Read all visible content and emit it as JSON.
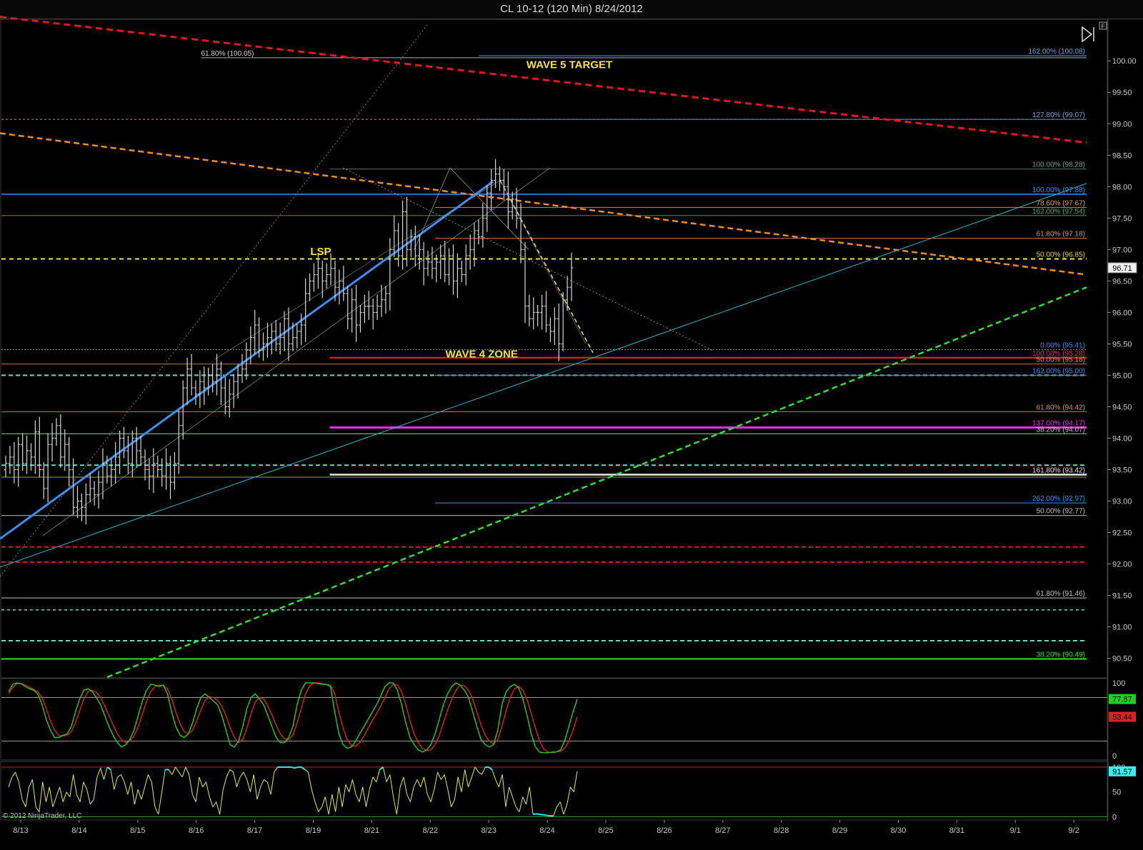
{
  "window": {
    "title": "CL 10-12 (120 Min)  8/24/2012"
  },
  "copyright": "© 2012 NinjaTrader, LLC",
  "colors": {
    "bar": "#d8d8d8",
    "red": "#e8141e",
    "orange": "#f28c1c",
    "green": "#2fe02f",
    "blue": "#3b8ff0",
    "cyan": "#1fb8c8",
    "yellow": "#f5e23c",
    "magenta": "#e62ee6",
    "teal_dash": "#58e0c8",
    "stoch_k": "#20d020",
    "stoch_d": "#e02020",
    "lower2": "#e8e84a",
    "lower2_hi": "#30e8f0"
  },
  "chart_data": [
    {
      "type": "candlestick",
      "symbol": "CL 10-12",
      "interval": "120 Min",
      "ylim": [
        90.2,
        100.65
      ],
      "yticks": [
        "100.00",
        "99.50",
        "99.00",
        "98.50",
        "98.00",
        "97.50",
        "97.00",
        "96.50",
        "96.00",
        "95.50",
        "95.00",
        "94.50",
        "94.00",
        "93.50",
        "93.00",
        "92.50",
        "92.00",
        "91.50",
        "91.00",
        "90.50"
      ],
      "xticks": [
        "8/13",
        "8/14",
        "8/15",
        "8/16",
        "8/17",
        "8/19",
        "8/21",
        "8/22",
        "8/23",
        "8/24",
        "8/25",
        "8/26",
        "8/27",
        "8/28",
        "8/29",
        "8/30",
        "8/31",
        "9/1",
        "9/2"
      ],
      "last_price": "96.71",
      "bars_close": [
        93.6,
        93.7,
        93.5,
        93.9,
        93.6,
        93.8,
        93.7,
        94.1,
        93.5,
        93.2,
        93.9,
        94.0,
        94.2,
        93.7,
        93.9,
        93.5,
        92.9,
        93.0,
        92.9,
        93.1,
        93.2,
        93.1,
        93.3,
        93.6,
        93.4,
        93.5,
        93.7,
        94.0,
        93.8,
        93.6,
        94.0,
        93.8,
        93.7,
        93.5,
        93.4,
        93.6,
        93.5,
        93.4,
        93.6,
        93.3,
        93.6,
        94.2,
        94.8,
        95.1,
        94.8,
        94.7,
        94.9,
        94.8,
        95.0,
        94.9,
        95.1,
        94.8,
        94.5,
        94.7,
        94.9,
        95.0,
        95.1,
        95.4,
        95.6,
        95.8,
        95.4,
        95.5,
        95.6,
        95.7,
        95.5,
        95.6,
        95.9,
        95.5,
        95.6,
        95.7,
        95.8,
        96.3,
        96.5,
        96.6,
        96.7,
        96.5,
        96.6,
        96.7,
        96.4,
        96.5,
        96.3,
        95.9,
        96.2,
        95.8,
        96.0,
        96.1,
        96.1,
        96.0,
        96.1,
        96.2,
        96.3,
        97.0,
        97.3,
        96.9,
        97.6,
        97.0,
        97.2,
        96.9,
        97.0,
        96.7,
        96.8,
        96.7,
        96.8,
        96.9,
        96.6,
        96.9,
        96.5,
        96.7,
        96.6,
        96.9,
        97.0,
        97.3,
        97.2,
        97.5,
        97.9,
        98.1,
        98.2,
        98.1,
        98.0,
        97.6,
        97.8,
        97.5,
        97.0,
        96.1,
        95.9,
        96.0,
        96.0,
        96.1,
        95.8,
        95.7,
        95.9,
        95.5,
        96.2,
        96.4,
        96.71
      ],
      "current_bar": {
        "open": 96.45,
        "high": 96.85,
        "low": 96.45,
        "close": 96.71
      },
      "annotations": [
        {
          "text": "WAVE 5 TARGET",
          "price": 99.95,
          "date_index": 9.5
        },
        {
          "text": "LSP",
          "price": 96.98,
          "date_index": 5.25
        },
        {
          "text": "WAVE 4 ZONE",
          "price": 95.35,
          "date_index": 8.0
        }
      ],
      "h_levels": [
        {
          "price": 100.05,
          "color": "#b0b0b0",
          "width": 1,
          "dash": "",
          "from": 3.4,
          "label": "61.80% (100.05)",
          "label_side": "left",
          "label_color": "#d0d0d0"
        },
        {
          "price": 100.08,
          "color": "#5aa8e8",
          "width": 1,
          "dash": "",
          "from": 8.15,
          "label": "162.00% (100.08)",
          "label_color": "#5aa8e8"
        },
        {
          "price": 99.07,
          "color": "#e08080",
          "width": 1,
          "dash": "3,3",
          "from": 0,
          "label": "127.80% (99.07)",
          "label_color": "#7aa0d8"
        },
        {
          "price": 99.07,
          "color": "#6090d0",
          "width": 1,
          "dash": "",
          "from": 8.1,
          "label": ""
        },
        {
          "price": 98.28,
          "color": "#607060",
          "width": 1,
          "dash": "",
          "from": 5.6,
          "label": "100.00% (98.28)",
          "label_color": "#58a8a0"
        },
        {
          "price": 97.88,
          "color": "#3b8ff0",
          "width": 1.5,
          "dash": "",
          "from": 0,
          "label": "100.00% (97.88)",
          "label_color": "#3b8ff0"
        },
        {
          "price": 97.67,
          "color": "#c88a4a",
          "width": 1,
          "dash": "",
          "from": 7.4,
          "label": "78.60% (97.67)",
          "label_color": "#e0a060"
        },
        {
          "price": 97.54,
          "color": "#3a9a3a",
          "width": 1,
          "dash": "",
          "from": 0,
          "label": "162.00% (97.54)",
          "label_color": "#40b040"
        },
        {
          "price": 97.18,
          "color": "#c07050",
          "width": 1,
          "dash": "",
          "from": 7.4,
          "label": "61.80% (97.18)",
          "label_color": "#e09070"
        },
        {
          "price": 96.85,
          "color": "#f5e23c",
          "width": 2,
          "dash": "6,5",
          "from": 0,
          "label": "50.00% (96.85)",
          "label_color": "#e8d040"
        },
        {
          "price": 95.41,
          "color": "#909090",
          "width": 1,
          "dash": "2,2",
          "from": 0,
          "label": "0.00% (95.41)",
          "label_color": "#3b8ff0"
        },
        {
          "price": 95.28,
          "color": "#d02020",
          "width": 2.5,
          "dash": "",
          "from": 5.6,
          "label": "100.00% (95.28)",
          "label_color": "#e03030"
        },
        {
          "price": 95.18,
          "color": "#c07050",
          "width": 1,
          "dash": "",
          "from": 0,
          "label": "50.00% (95.18)",
          "label_color": "#e09070"
        },
        {
          "price": 95.0,
          "color": "#58e0c8",
          "width": 2,
          "dash": "6,4",
          "from": 0,
          "label": ""
        },
        {
          "price": 95.0,
          "color": "#3b8ff0",
          "width": 1,
          "dash": "",
          "from": 7.4,
          "label": "162.00% (95.00)",
          "label_color": "#3b8ff0"
        },
        {
          "price": 94.42,
          "color": "#c07050",
          "width": 1,
          "dash": "",
          "from": 0,
          "label": "61.80% (94.42)",
          "label_color": "#e09070"
        },
        {
          "price": 94.17,
          "color": "#e62ee6",
          "width": 3,
          "dash": "",
          "from": 5.6,
          "label": "137.00% (94.17)",
          "label_color": "#e62ee6"
        },
        {
          "price": 94.07,
          "color": "#a0d0a0",
          "width": 1,
          "dash": "",
          "from": 0,
          "label": "38.20% (94.07)",
          "label_color": "#c0c0c0"
        },
        {
          "price": 93.57,
          "color": "#58e0c8",
          "width": 2,
          "dash": "6,4",
          "from": 0,
          "label": ""
        },
        {
          "price": 93.42,
          "color": "#e8e8e8",
          "width": 2.5,
          "dash": "",
          "from": 5.6,
          "label": "161.80% (93.42)",
          "label_color": "#e0e0e0"
        },
        {
          "price": 93.38,
          "color": "#a0a040",
          "width": 1,
          "dash": "",
          "from": 0,
          "label": ""
        },
        {
          "price": 92.97,
          "color": "#3b8ff0",
          "width": 1,
          "dash": "",
          "from": 7.4,
          "label": "262.00% (92.97)",
          "label_color": "#3b8ff0"
        },
        {
          "price": 92.77,
          "color": "#b0d0b0",
          "width": 1,
          "dash": "",
          "from": 0,
          "label": "50.00% (92.77)",
          "label_color": "#c0c0c0"
        },
        {
          "price": 92.27,
          "color": "#e8141e",
          "width": 2,
          "dash": "6,4",
          "from": 0,
          "label": ""
        },
        {
          "price": 92.03,
          "color": "#e8141e",
          "width": 2,
          "dash": "6,4",
          "from": 0,
          "label": ""
        },
        {
          "price": 91.46,
          "color": "#b0d0b0",
          "width": 1,
          "dash": "",
          "from": 0,
          "label": "61.80% (91.46)",
          "label_color": "#c0c0c0"
        },
        {
          "price": 91.27,
          "color": "#58e0c8",
          "width": 1.5,
          "dash": "4,4",
          "from": 0,
          "label": ""
        },
        {
          "price": 90.78,
          "color": "#58e0c8",
          "width": 2,
          "dash": "6,4",
          "from": 0,
          "label": ""
        },
        {
          "price": 90.49,
          "color": "#2fe02f",
          "width": 2,
          "dash": "",
          "from": 0,
          "label": "38.20% (90.49)",
          "label_color": "#2fe02f"
        }
      ]
    },
    {
      "type": "line",
      "name": "stochastics",
      "ylim": [
        -5,
        105
      ],
      "yticks": [
        "100",
        "0"
      ],
      "k": [
        88,
        98,
        100,
        99,
        95,
        92,
        90,
        85,
        70,
        50,
        35,
        25,
        25,
        28,
        30,
        40,
        60,
        78,
        90,
        92,
        88,
        80,
        70,
        55,
        40,
        28,
        18,
        12,
        15,
        22,
        35,
        55,
        75,
        90,
        98,
        97,
        95,
        97,
        85,
        60,
        40,
        28,
        25,
        30,
        45,
        65,
        80,
        85,
        80,
        75,
        70,
        55,
        35,
        15,
        12,
        20,
        40,
        65,
        80,
        85,
        78,
        70,
        55,
        40,
        25,
        18,
        18,
        25,
        40,
        70,
        90,
        100,
        100,
        100,
        99,
        98,
        98,
        95,
        60,
        30,
        15,
        10,
        12,
        20,
        30,
        40,
        50,
        60,
        70,
        82,
        95,
        100,
        100,
        90,
        70,
        45,
        25,
        15,
        8,
        5,
        8,
        15,
        30,
        50,
        70,
        85,
        95,
        100,
        97,
        90,
        80,
        60,
        40,
        22,
        15,
        12,
        15,
        35,
        70,
        88,
        95,
        98,
        93,
        78,
        55,
        30,
        12,
        5,
        4,
        4,
        5,
        5,
        8,
        20,
        40,
        60,
        77.87
      ],
      "d": [
        85,
        94,
        99,
        99,
        97,
        94,
        91,
        88,
        80,
        65,
        48,
        35,
        28,
        27,
        28,
        33,
        45,
        62,
        78,
        88,
        90,
        87,
        80,
        68,
        55,
        42,
        30,
        22,
        18,
        20,
        27,
        40,
        57,
        75,
        88,
        95,
        97,
        96,
        92,
        78,
        60,
        44,
        33,
        30,
        35,
        48,
        63,
        76,
        81,
        80,
        76,
        68,
        55,
        38,
        25,
        18,
        22,
        38,
        58,
        74,
        80,
        78,
        68,
        56,
        42,
        30,
        23,
        22,
        28,
        45,
        65,
        85,
        96,
        100,
        100,
        99,
        98,
        97,
        85,
        60,
        38,
        22,
        14,
        13,
        18,
        27,
        38,
        48,
        58,
        68,
        80,
        92,
        98,
        97,
        88,
        70,
        48,
        30,
        18,
        10,
        7,
        8,
        15,
        28,
        45,
        63,
        78,
        90,
        97,
        96,
        90,
        78,
        60,
        42,
        28,
        20,
        16,
        22,
        40,
        62,
        80,
        92,
        95,
        90,
        77,
        58,
        38,
        20,
        9,
        5,
        4,
        5,
        6,
        10,
        20,
        35,
        53.44
      ],
      "values": [
        "77.87",
        "53.44"
      ]
    },
    {
      "type": "line",
      "name": "oscillator",
      "ylim": [
        -5,
        110
      ],
      "yticks": [
        "100",
        "50",
        "0"
      ],
      "values": [
        60,
        80,
        90,
        70,
        35,
        20,
        60,
        75,
        20,
        10,
        70,
        30,
        60,
        20,
        40,
        60,
        30,
        50,
        40,
        85,
        45,
        30,
        70,
        55,
        25,
        35,
        80,
        98,
        75,
        100,
        95,
        55,
        80,
        85,
        70,
        45,
        70,
        25,
        55,
        35,
        60,
        85,
        70,
        20,
        5,
        50,
        95,
        95,
        85,
        100,
        90,
        80,
        100,
        85,
        45,
        30,
        80,
        60,
        70,
        40,
        20,
        30,
        5,
        55,
        80,
        95,
        90,
        60,
        80,
        90,
        75,
        50,
        85,
        35,
        60,
        75,
        70,
        45,
        90,
        100,
        100,
        100,
        100,
        100,
        98,
        100,
        100,
        95,
        90,
        55,
        30,
        10,
        20,
        40,
        5,
        45,
        10,
        60,
        20,
        65,
        50,
        75,
        45,
        30,
        60,
        20,
        55,
        80,
        70,
        95,
        100,
        70,
        85,
        40,
        5,
        60,
        80,
        45,
        30,
        60,
        75,
        60,
        80,
        45,
        30,
        55,
        90,
        75,
        85,
        55,
        20,
        35,
        80,
        50,
        95,
        60,
        80,
        100,
        90,
        85,
        100,
        100,
        95,
        75,
        60,
        85,
        20,
        60,
        40,
        20,
        10,
        40,
        25,
        60,
        5,
        6,
        5,
        4,
        3,
        2,
        2,
        20,
        30,
        5,
        25,
        60,
        50,
        91.57
      ],
      "last": "91.57"
    }
  ]
}
